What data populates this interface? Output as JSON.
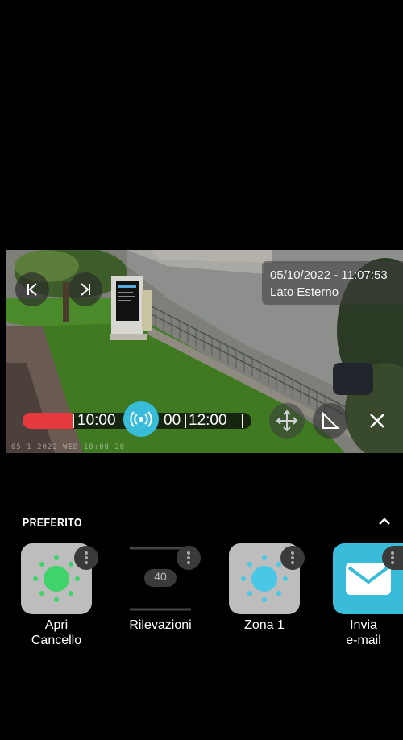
{
  "camera": {
    "datetime": "05/10/2022 - 11:07:53",
    "location": "Lato Esterno",
    "osd_timestamp": "05 1 2022 WED 10:08 28",
    "timeline": {
      "labels": [
        "10:00",
        "00",
        "12:00"
      ],
      "played_color": "#e5393d",
      "live_color": "#38bcd9"
    }
  },
  "favorites": {
    "header": "PREFERITO",
    "tiles": [
      {
        "label": "Apri Cancello",
        "icon": "sun-green-icon",
        "bg": "#bdbdbd",
        "accent": "#3fd46b"
      },
      {
        "label": "Rilevazioni",
        "icon": "counter-icon",
        "badge": "40",
        "bg": "#000000"
      },
      {
        "label": "Zona 1",
        "icon": "sun-blue-icon",
        "bg": "#bdbdbd",
        "accent": "#48c8e6"
      },
      {
        "label": "Invia e-mail",
        "icon": "mail-icon",
        "bg": "#38bcd9"
      }
    ]
  }
}
